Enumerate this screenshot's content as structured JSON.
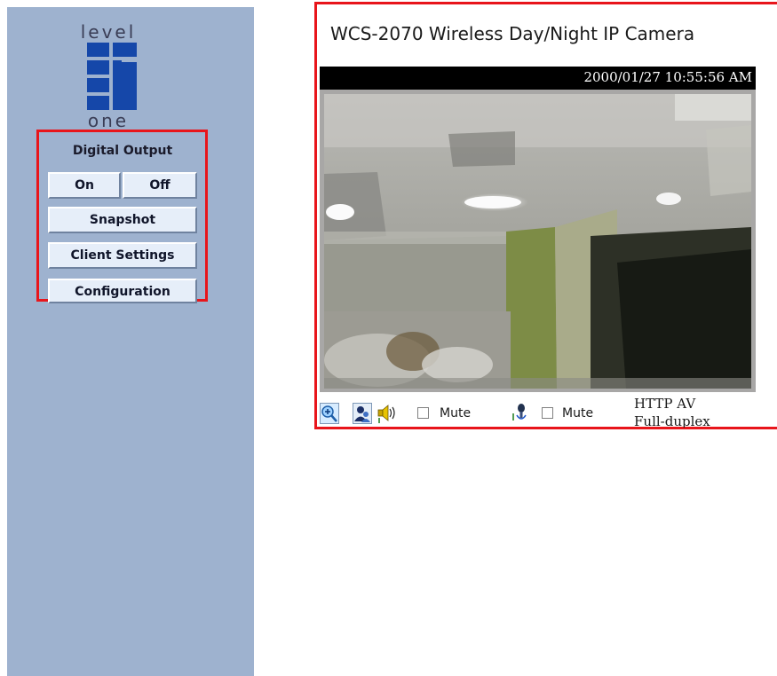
{
  "logo": {
    "top_text": "level",
    "bottom_text": "one",
    "color": "#1547a9"
  },
  "sidebar": {
    "background": "#9eb2cf",
    "digital_output_label": "Digital Output",
    "buttons": {
      "on": "On",
      "off": "Off",
      "snapshot": "Snapshot",
      "client_settings": "Client Settings",
      "configuration": "Configuration"
    }
  },
  "camera": {
    "title": "WCS-2070 Wireless Day/Night IP Camera",
    "timestamp": "2000/01/27 10:55:56 AM"
  },
  "toolbar": {
    "icons": [
      "zoom-in-icon",
      "user-icon",
      "speaker-icon",
      "microphone-icon"
    ],
    "speaker_mute_label": "Mute",
    "speaker_mute_checked": false,
    "mic_mute_label": "Mute",
    "mic_mute_checked": false,
    "protocol": "HTTP   AV",
    "duplex": "Full-duplex"
  },
  "highlight_color": "#e8151b"
}
